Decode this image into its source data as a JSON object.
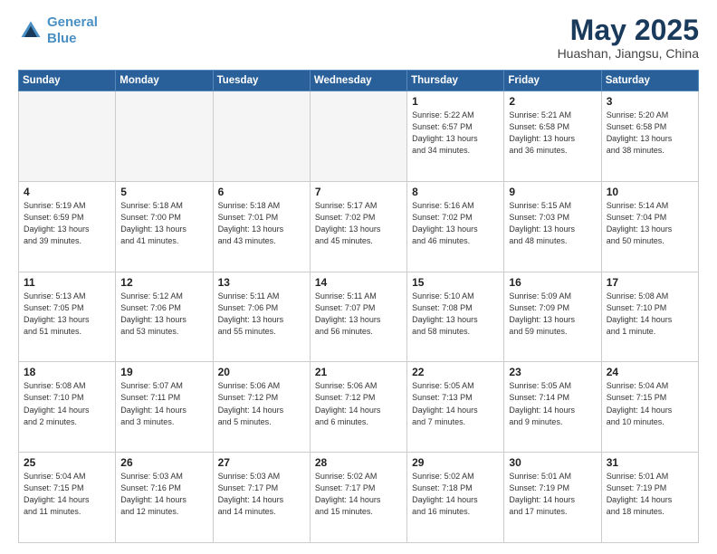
{
  "header": {
    "logo_line1": "General",
    "logo_line2": "Blue",
    "month_year": "May 2025",
    "location": "Huashan, Jiangsu, China"
  },
  "weekdays": [
    "Sunday",
    "Monday",
    "Tuesday",
    "Wednesday",
    "Thursday",
    "Friday",
    "Saturday"
  ],
  "weeks": [
    [
      {
        "day": "",
        "info": ""
      },
      {
        "day": "",
        "info": ""
      },
      {
        "day": "",
        "info": ""
      },
      {
        "day": "",
        "info": ""
      },
      {
        "day": "1",
        "info": "Sunrise: 5:22 AM\nSunset: 6:57 PM\nDaylight: 13 hours\nand 34 minutes."
      },
      {
        "day": "2",
        "info": "Sunrise: 5:21 AM\nSunset: 6:58 PM\nDaylight: 13 hours\nand 36 minutes."
      },
      {
        "day": "3",
        "info": "Sunrise: 5:20 AM\nSunset: 6:58 PM\nDaylight: 13 hours\nand 38 minutes."
      }
    ],
    [
      {
        "day": "4",
        "info": "Sunrise: 5:19 AM\nSunset: 6:59 PM\nDaylight: 13 hours\nand 39 minutes."
      },
      {
        "day": "5",
        "info": "Sunrise: 5:18 AM\nSunset: 7:00 PM\nDaylight: 13 hours\nand 41 minutes."
      },
      {
        "day": "6",
        "info": "Sunrise: 5:18 AM\nSunset: 7:01 PM\nDaylight: 13 hours\nand 43 minutes."
      },
      {
        "day": "7",
        "info": "Sunrise: 5:17 AM\nSunset: 7:02 PM\nDaylight: 13 hours\nand 45 minutes."
      },
      {
        "day": "8",
        "info": "Sunrise: 5:16 AM\nSunset: 7:02 PM\nDaylight: 13 hours\nand 46 minutes."
      },
      {
        "day": "9",
        "info": "Sunrise: 5:15 AM\nSunset: 7:03 PM\nDaylight: 13 hours\nand 48 minutes."
      },
      {
        "day": "10",
        "info": "Sunrise: 5:14 AM\nSunset: 7:04 PM\nDaylight: 13 hours\nand 50 minutes."
      }
    ],
    [
      {
        "day": "11",
        "info": "Sunrise: 5:13 AM\nSunset: 7:05 PM\nDaylight: 13 hours\nand 51 minutes."
      },
      {
        "day": "12",
        "info": "Sunrise: 5:12 AM\nSunset: 7:06 PM\nDaylight: 13 hours\nand 53 minutes."
      },
      {
        "day": "13",
        "info": "Sunrise: 5:11 AM\nSunset: 7:06 PM\nDaylight: 13 hours\nand 55 minutes."
      },
      {
        "day": "14",
        "info": "Sunrise: 5:11 AM\nSunset: 7:07 PM\nDaylight: 13 hours\nand 56 minutes."
      },
      {
        "day": "15",
        "info": "Sunrise: 5:10 AM\nSunset: 7:08 PM\nDaylight: 13 hours\nand 58 minutes."
      },
      {
        "day": "16",
        "info": "Sunrise: 5:09 AM\nSunset: 7:09 PM\nDaylight: 13 hours\nand 59 minutes."
      },
      {
        "day": "17",
        "info": "Sunrise: 5:08 AM\nSunset: 7:10 PM\nDaylight: 14 hours\nand 1 minute."
      }
    ],
    [
      {
        "day": "18",
        "info": "Sunrise: 5:08 AM\nSunset: 7:10 PM\nDaylight: 14 hours\nand 2 minutes."
      },
      {
        "day": "19",
        "info": "Sunrise: 5:07 AM\nSunset: 7:11 PM\nDaylight: 14 hours\nand 3 minutes."
      },
      {
        "day": "20",
        "info": "Sunrise: 5:06 AM\nSunset: 7:12 PM\nDaylight: 14 hours\nand 5 minutes."
      },
      {
        "day": "21",
        "info": "Sunrise: 5:06 AM\nSunset: 7:12 PM\nDaylight: 14 hours\nand 6 minutes."
      },
      {
        "day": "22",
        "info": "Sunrise: 5:05 AM\nSunset: 7:13 PM\nDaylight: 14 hours\nand 7 minutes."
      },
      {
        "day": "23",
        "info": "Sunrise: 5:05 AM\nSunset: 7:14 PM\nDaylight: 14 hours\nand 9 minutes."
      },
      {
        "day": "24",
        "info": "Sunrise: 5:04 AM\nSunset: 7:15 PM\nDaylight: 14 hours\nand 10 minutes."
      }
    ],
    [
      {
        "day": "25",
        "info": "Sunrise: 5:04 AM\nSunset: 7:15 PM\nDaylight: 14 hours\nand 11 minutes."
      },
      {
        "day": "26",
        "info": "Sunrise: 5:03 AM\nSunset: 7:16 PM\nDaylight: 14 hours\nand 12 minutes."
      },
      {
        "day": "27",
        "info": "Sunrise: 5:03 AM\nSunset: 7:17 PM\nDaylight: 14 hours\nand 14 minutes."
      },
      {
        "day": "28",
        "info": "Sunrise: 5:02 AM\nSunset: 7:17 PM\nDaylight: 14 hours\nand 15 minutes."
      },
      {
        "day": "29",
        "info": "Sunrise: 5:02 AM\nSunset: 7:18 PM\nDaylight: 14 hours\nand 16 minutes."
      },
      {
        "day": "30",
        "info": "Sunrise: 5:01 AM\nSunset: 7:19 PM\nDaylight: 14 hours\nand 17 minutes."
      },
      {
        "day": "31",
        "info": "Sunrise: 5:01 AM\nSunset: 7:19 PM\nDaylight: 14 hours\nand 18 minutes."
      }
    ]
  ]
}
